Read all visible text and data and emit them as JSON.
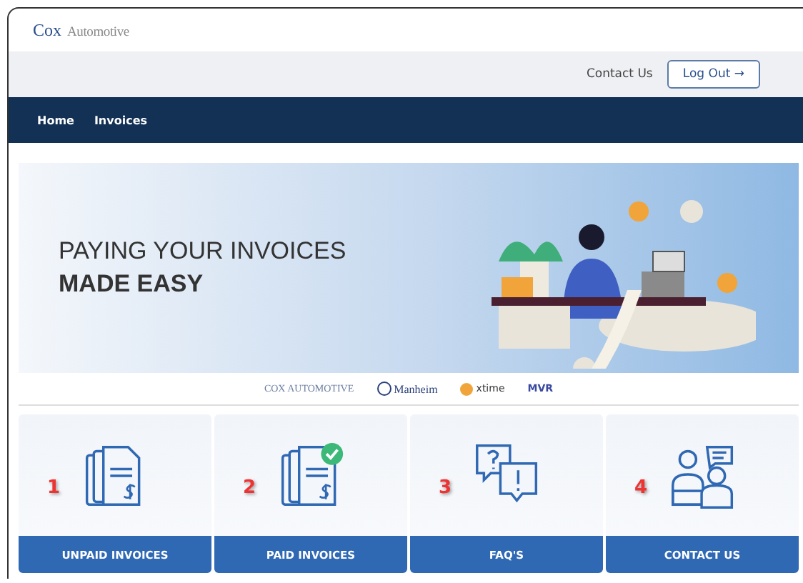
{
  "header": {
    "logo": {
      "first": "Cox",
      "second": "Automotive"
    }
  },
  "utility_bar": {
    "link": "Contact Us",
    "button": "Log Out",
    "button_icon": "→"
  },
  "nav": {
    "items": [
      {
        "label": "Home",
        "selected": false
      },
      {
        "label": "Invoices",
        "selected": false
      }
    ]
  },
  "hero": {
    "line1": "PAYING YOUR INVOICES",
    "line2": "MADE EASY"
  },
  "partners": [
    {
      "kind": "cox",
      "name": "COX AUTOMOTIVE"
    },
    {
      "kind": "manheim",
      "name": "Manheim"
    },
    {
      "kind": "xtime",
      "name": "xtime"
    },
    {
      "kind": "mvr",
      "name": "MVR"
    }
  ],
  "cards": [
    {
      "kind": "unpaid",
      "number": "1",
      "label": "UNPAID INVOICES"
    },
    {
      "kind": "paid",
      "number": "2",
      "label": "PAID INVOICES"
    },
    {
      "kind": "faq",
      "number": "3",
      "label": "FAQ'S"
    },
    {
      "kind": "contact",
      "number": "4",
      "label": "CONTACT US"
    }
  ]
}
